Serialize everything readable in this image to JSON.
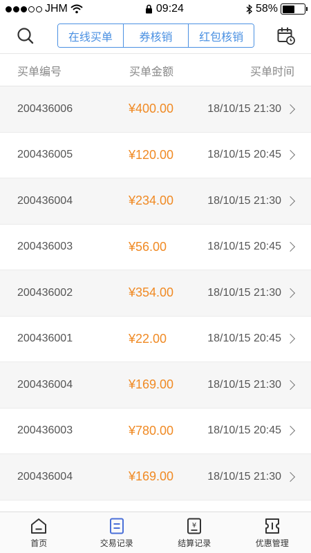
{
  "status_bar": {
    "carrier": "JHM",
    "time": "09:24",
    "battery": "58%",
    "battery_level": 0.58
  },
  "header": {
    "segments": [
      {
        "label": "在线买单",
        "active": true
      },
      {
        "label": "券核销",
        "active": false
      },
      {
        "label": "红包核销",
        "active": false
      }
    ]
  },
  "columns": {
    "id": "买单编号",
    "amount": "买单金额",
    "time": "买单时间"
  },
  "orders": [
    {
      "id": "200436006",
      "amount": "¥400.00",
      "time": "18/10/15 21:30"
    },
    {
      "id": "200436005",
      "amount": "¥120.00",
      "time": "18/10/15 20:45"
    },
    {
      "id": "200436004",
      "amount": "¥234.00",
      "time": "18/10/15 21:30"
    },
    {
      "id": "200436003",
      "amount": "¥56.00",
      "time": "18/10/15 20:45"
    },
    {
      "id": "200436002",
      "amount": "¥354.00",
      "time": "18/10/15 21:30"
    },
    {
      "id": "200436001",
      "amount": "¥22.00",
      "time": "18/10/15 20:45"
    },
    {
      "id": "200436004",
      "amount": "¥169.00",
      "time": "18/10/15 21:30"
    },
    {
      "id": "200436003",
      "amount": "¥780.00",
      "time": "18/10/15 20:45"
    },
    {
      "id": "200436004",
      "amount": "¥169.00",
      "time": "18/10/15 21:30"
    }
  ],
  "tabbar": [
    {
      "label": "首页",
      "icon": "home-icon"
    },
    {
      "label": "交易记录",
      "icon": "transactions-icon",
      "active": true
    },
    {
      "label": "结算记录",
      "icon": "settlement-icon"
    },
    {
      "label": "优惠管理",
      "icon": "coupon-icon"
    }
  ],
  "colors": {
    "accent": "#4a90e2",
    "amount": "#f08a24",
    "active_tab_icon": "#4a6fd8"
  }
}
